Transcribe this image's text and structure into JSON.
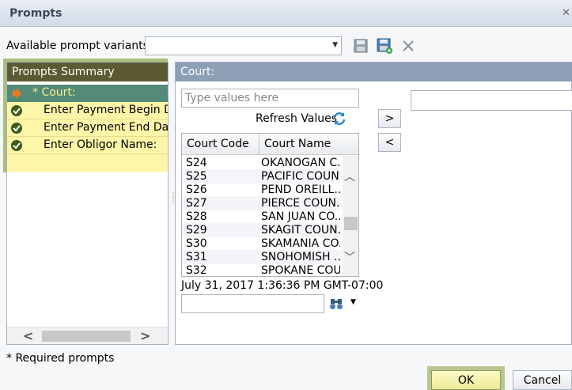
{
  "dialog": {
    "title": "Prompts",
    "close_glyph": "✕"
  },
  "variants": {
    "label": "Available prompt variants",
    "selected": ""
  },
  "summary": {
    "header": "Prompts Summary",
    "items": [
      {
        "label": "* Court:",
        "icon": "current-arrow-icon",
        "state": "current"
      },
      {
        "label": "Enter Payment Begin Date",
        "icon": "check-circle-icon",
        "state": "done"
      },
      {
        "label": "Enter Payment End Date:",
        "icon": "check-circle-icon",
        "state": "done"
      },
      {
        "label": "Enter Obligor Name:",
        "icon": "check-circle-icon",
        "state": "done"
      }
    ]
  },
  "court": {
    "header": "Court:",
    "type_placeholder": "Type values here",
    "refresh_label": "Refresh Values",
    "move_right": ">",
    "move_left": "<",
    "columns": [
      "Court Code",
      "Court Name"
    ],
    "rows": [
      {
        "code": "S24",
        "name": "OKANOGAN C..."
      },
      {
        "code": "S25",
        "name": "PACIFIC COUN..."
      },
      {
        "code": "S26",
        "name": "PEND OREILL..."
      },
      {
        "code": "S27",
        "name": "PIERCE COUN..."
      },
      {
        "code": "S28",
        "name": "SAN JUAN CO..."
      },
      {
        "code": "S29",
        "name": "SKAGIT COUN..."
      },
      {
        "code": "S30",
        "name": "SKAMANIA CO..."
      },
      {
        "code": "S31",
        "name": "SNOHOMISH ..."
      },
      {
        "code": "S32",
        "name": "SPOKANE COU..."
      }
    ],
    "timestamp": "July 31, 2017 1:36:36 PM GMT-07:00",
    "search_value": ""
  },
  "footer": {
    "required_note": "* Required prompts",
    "ok_label": "OK",
    "cancel_label": "Cancel"
  },
  "colors": {
    "summary_header": "#5b5a33",
    "summary_bg": "#fdf6a8",
    "current_row": "#548a78",
    "court_header": "#8c9fb5",
    "ok_button": "#ede99a"
  }
}
